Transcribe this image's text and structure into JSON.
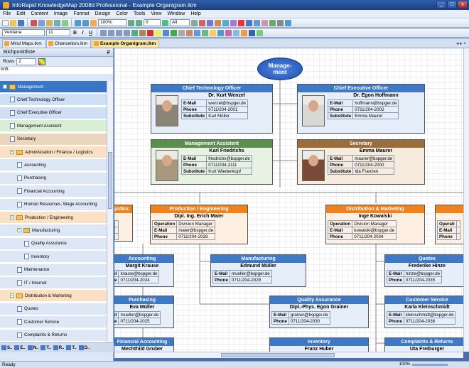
{
  "window": {
    "title": "InfoRapid KnowledgeMap 2008d Professional - Example Organigram.ikm",
    "minimize": "_",
    "maximize": "□",
    "close": "x"
  },
  "menu": [
    "File",
    "Edit",
    "Content",
    "Image",
    "Format",
    "Design",
    "Color",
    "Tools",
    "View",
    "Window",
    "Help"
  ],
  "toolbar": {
    "zoom": "100%",
    "zoom2": "0",
    "filter": "All",
    "font": "Verdana",
    "font_size": "11",
    "bold": "B",
    "underline": "U",
    "italic": "I"
  },
  "tabs": [
    {
      "label": "Mind Maps.ikm",
      "active": false
    },
    {
      "label": "Chancellors.ikm",
      "active": false
    },
    {
      "label": "Example Organigram.ikm",
      "active": true
    }
  ],
  "tab_controls": "◂ ▸ ×",
  "left_panel": {
    "title": "Stichpunktliste",
    "pin": "₽",
    "rows_label": "Rows",
    "rows_value": "2",
    "cut_text": "hrift",
    "bottom_tabs": [
      "S..",
      "E..",
      "N..",
      "T..",
      "R..",
      "T..",
      "D.."
    ]
  },
  "tree": [
    {
      "label": "Management",
      "level": 0,
      "kind": "folder",
      "bg": "#3a76c8",
      "fg": "#ffffff"
    },
    {
      "label": "Chief Technology Officer",
      "level": 1,
      "kind": "node",
      "bg": "#cfe0f6",
      "fg": "#000000"
    },
    {
      "label": "Chief Executive Officer",
      "level": 1,
      "kind": "node",
      "bg": "#cfe0f6",
      "fg": "#000000"
    },
    {
      "label": "Management Assistent",
      "level": 1,
      "kind": "node",
      "bg": "#d9eed4",
      "fg": "#000000"
    },
    {
      "label": "Secretary",
      "level": 1,
      "kind": "node",
      "bg": "#ecd5bd",
      "fg": "#000000"
    },
    {
      "label": "Administration / Finance / Logistics",
      "level": 1,
      "kind": "folder",
      "bg": "#fbe0c3",
      "fg": "#000000"
    },
    {
      "label": "Accounting",
      "level": 2,
      "kind": "node",
      "bg": "#dde7f5",
      "fg": "#000000"
    },
    {
      "label": "Purchasing",
      "level": 2,
      "kind": "node",
      "bg": "#dde7f5",
      "fg": "#000000"
    },
    {
      "label": "Financial Accounting",
      "level": 2,
      "kind": "node",
      "bg": "#dde7f5",
      "fg": "#000000"
    },
    {
      "label": "Human Resources, Wage Accounting",
      "level": 2,
      "kind": "node",
      "bg": "#dde7f5",
      "fg": "#000000"
    },
    {
      "label": "Production / Engineering",
      "level": 1,
      "kind": "folder",
      "bg": "#fbe0c3",
      "fg": "#000000"
    },
    {
      "label": "Manufacturing",
      "level": 2,
      "kind": "folder",
      "bg": "#dde7f5",
      "fg": "#000000"
    },
    {
      "label": "Quality Assurance",
      "level": 3,
      "kind": "node",
      "bg": "#dde7f5",
      "fg": "#000000"
    },
    {
      "label": "Inventory",
      "level": 3,
      "kind": "node",
      "bg": "#dde7f5",
      "fg": "#000000"
    },
    {
      "label": "Maintenance",
      "level": 2,
      "kind": "node",
      "bg": "#dde7f5",
      "fg": "#000000"
    },
    {
      "label": "IT / Internet",
      "level": 2,
      "kind": "node",
      "bg": "#dde7f5",
      "fg": "#000000"
    },
    {
      "label": "Distribution & Marketing",
      "level": 1,
      "kind": "folder",
      "bg": "#fbe0c3",
      "fg": "#000000"
    },
    {
      "label": "Quotes",
      "level": 2,
      "kind": "node",
      "bg": "#dde7f5",
      "fg": "#000000"
    },
    {
      "label": "Customer Service",
      "level": 2,
      "kind": "node",
      "bg": "#dde7f5",
      "fg": "#000000"
    },
    {
      "label": "Complaints & Returns",
      "level": 2,
      "kind": "node",
      "bg": "#dde7f5",
      "fg": "#000000"
    }
  ],
  "chart": {
    "root": "Manage-\nment",
    "cards": [
      {
        "id": "cto",
        "color": "blue",
        "title": "Chief Technology Officer",
        "name": "Dr. Kurt Wenzel",
        "photo": "man-gray",
        "rows": [
          [
            "E-Mail",
            "wenzel@bspger.de"
          ],
          [
            "Phone",
            "0711/204-2001"
          ],
          [
            "Substitute",
            "Karl Müller"
          ]
        ]
      },
      {
        "id": "ceo",
        "color": "blue",
        "title": "Chief Executive Officer",
        "name": "Dr. Egon Hoffmann",
        "photo": "man-white",
        "rows": [
          [
            "E-Mail",
            "hoffmann@bspger.de"
          ],
          [
            "Phone",
            "0711/204-2002"
          ],
          [
            "Substitute",
            "Emma Maurer"
          ]
        ]
      },
      {
        "id": "assist",
        "color": "green",
        "title": "Management Assistent",
        "name": "Karl Friedrichs",
        "photo": "man-glasses",
        "rows": [
          [
            "E-Mail",
            "friedrichs@bspger.de"
          ],
          [
            "Phone",
            "0711/204-2111"
          ],
          [
            "Substitute",
            "Kurt Wiedenkopf"
          ]
        ]
      },
      {
        "id": "secretary",
        "color": "brown",
        "title": "Secretary",
        "name": "Emma Maurer",
        "photo": "woman",
        "rows": [
          [
            "E-Mail",
            "maurer@bspger.de"
          ],
          [
            "Phone",
            "0711/204-2000"
          ],
          [
            "Substitute",
            "Ida Franzen"
          ]
        ]
      },
      {
        "id": "logistics",
        "color": "orange",
        "title": "gistics",
        "name": "",
        "rows": [
          [
            "",
            ""
          ],
          [
            "",
            ""
          ],
          [
            "",
            ""
          ]
        ]
      },
      {
        "id": "production",
        "color": "orange",
        "title": "Production / Engineering",
        "name": "Dipl. Ing. Erich Maier",
        "rows": [
          [
            "Operation",
            "Division Manager"
          ],
          [
            "E-Mail",
            "maier@bspger.de"
          ],
          [
            "Phone",
            "0711/204-2028"
          ]
        ]
      },
      {
        "id": "distribution",
        "color": "orange",
        "title": "Distribution & Marketing",
        "name": "Inge Kowalski",
        "rows": [
          [
            "Operation",
            "Division Manager"
          ],
          [
            "E-Mail",
            "kowalski@bspger.de"
          ],
          [
            "Phone",
            "0711/204-2034"
          ]
        ]
      },
      {
        "id": "right-partial",
        "color": "orange",
        "title": "",
        "name": "",
        "rows": [
          [
            "Operati",
            ""
          ],
          [
            "E-Mail",
            ""
          ],
          [
            "Phone",
            ""
          ]
        ]
      },
      {
        "id": "accounting",
        "color": "blue",
        "title": "Accounting",
        "name": "Margit Krause",
        "rows": [
          [
            "il",
            "krause@bspger.de"
          ],
          [
            "e",
            "0711/204-2024"
          ]
        ]
      },
      {
        "id": "manufacturing",
        "color": "blue",
        "title": "Manufacturing",
        "name": "Edmund Müller",
        "rows": [
          [
            "E-Mail",
            "mueller@bspger.de"
          ],
          [
            "Phone",
            "0711/204-2029"
          ]
        ]
      },
      {
        "id": "quotes",
        "color": "blue",
        "title": "Quotes",
        "name": "Frederike Hinze",
        "rows": [
          [
            "E-Mail",
            "hinze@bspger.de"
          ],
          [
            "Phone",
            "0711/204-2035"
          ]
        ]
      },
      {
        "id": "purchasing",
        "color": "blue",
        "title": "Purchasing",
        "name": "Eva Müller",
        "rows": [
          [
            "il",
            "mueller@bspger.de"
          ],
          [
            "e",
            "0711/204-2025"
          ]
        ]
      },
      {
        "id": "quality",
        "color": "blue",
        "title": "Quality Assurance",
        "name": "Dipl.-Phys. Egon Grainer",
        "rows": [
          [
            "E-Mail",
            "grainer@bspger.de"
          ],
          [
            "Phone",
            "0711/204-2030"
          ]
        ]
      },
      {
        "id": "service",
        "color": "blue",
        "title": "Customer Service",
        "name": "Karla Kleinschmidt",
        "rows": [
          [
            "E-Mail",
            "kleinschmidt@bspger.de"
          ],
          [
            "Phone",
            "0711/204-2036"
          ]
        ]
      },
      {
        "id": "finacc",
        "color": "blue",
        "title": "Financial Accounting",
        "name": "Mechthild Gruber",
        "rows": []
      },
      {
        "id": "inventory",
        "color": "blue",
        "title": "Inventory",
        "name": "Franz Huber",
        "rows": []
      },
      {
        "id": "complaints",
        "color": "blue",
        "title": "Complaints & Returns",
        "name": "Uta Freiburger",
        "rows": []
      }
    ]
  },
  "status": {
    "text": "Ready",
    "zoom": "100%"
  },
  "colors": {
    "accent": "#3d79c6",
    "orange": "#f0821e",
    "green": "#5b8f4e",
    "brown": "#9a6d3a"
  }
}
